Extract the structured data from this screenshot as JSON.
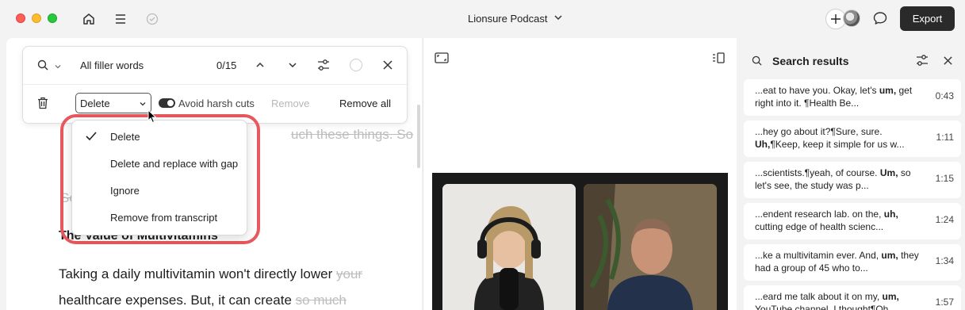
{
  "window": {
    "title": "Lionsure Podcast",
    "export_label": "Export"
  },
  "find_bar": {
    "query": "All filler words",
    "count": "0/15",
    "action_select": "Delete",
    "avoid_harsh_cuts": "Avoid harsh cuts",
    "avoid_harsh_cuts_on": true,
    "remove_label": "Remove",
    "remove_all_label": "Remove all"
  },
  "action_menu": {
    "items": [
      {
        "label": "Delete",
        "checked": true
      },
      {
        "label": "Delete and replace with gap",
        "checked": false
      },
      {
        "label": "Ignore",
        "checked": false
      },
      {
        "label": "Remove from transcript",
        "checked": false
      }
    ],
    "highlight_color": "#e8585e"
  },
  "transcript": {
    "partial_line_1": "uch these things. So",
    "partial_line_2": "",
    "partial_line_3": "Se",
    "heading": "The Value of Multivitamins",
    "line_a_main": "Taking a daily multivitamin won't directly lower",
    "line_a_struck": "your",
    "line_b_main": "healthcare expenses. But, it can create",
    "line_b_struck": "so much"
  },
  "search_panel": {
    "title": "Search results",
    "results": [
      {
        "pre": "...eat to have you. Okay, let's ",
        "bold": "um,",
        "post": " get right into it. ¶Health Be...",
        "time": "0:43"
      },
      {
        "pre": "...hey go about it?¶Sure, sure. ",
        "bold": "Uh,",
        "post": "¶Keep, keep it simple for us w...",
        "time": "1:11"
      },
      {
        "pre": "...scientists.¶yeah, of course. ",
        "bold": "Um,",
        "post": " so let's see, the study was p...",
        "time": "1:15"
      },
      {
        "pre": "...endent research lab. on the, ",
        "bold": "uh,",
        "post": " cutting edge of health scienc...",
        "time": "1:24"
      },
      {
        "pre": "...ke a multivitamin ever. And, ",
        "bold": "um,",
        "post": " they had a group of 45 who to...",
        "time": "1:34"
      },
      {
        "pre": "...eard me talk about it on my, ",
        "bold": "um,",
        "post": " YouTube channel. I thought¶Oh...",
        "time": "1:57"
      }
    ]
  },
  "colors": {
    "accent_red": "#e8585e",
    "export_bg": "#2a2a2a"
  }
}
